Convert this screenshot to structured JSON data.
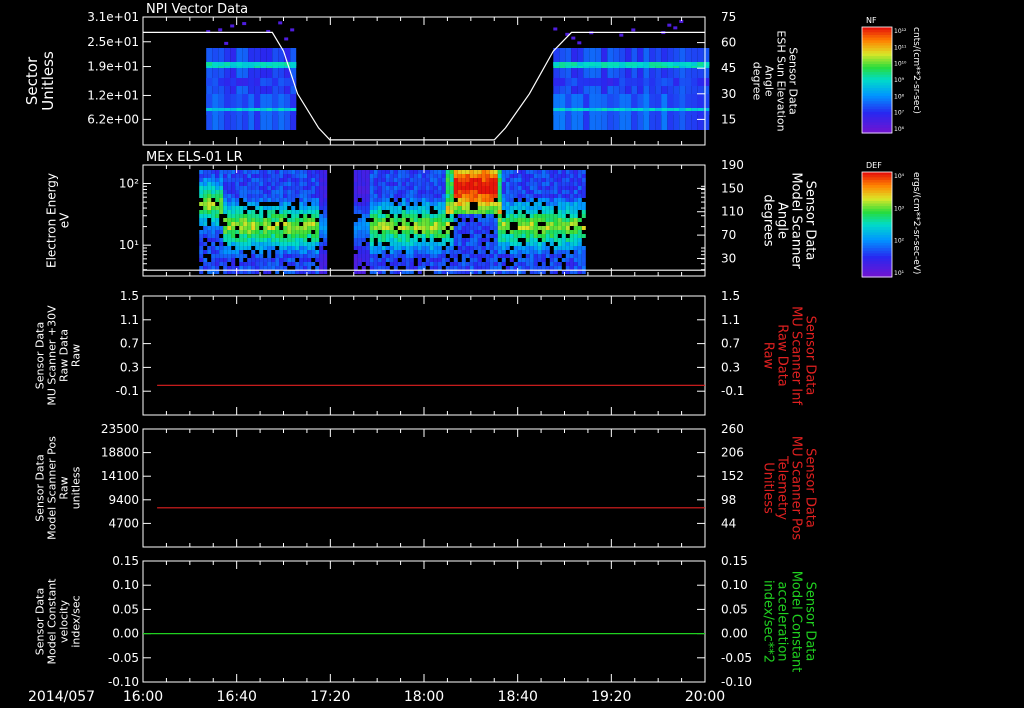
{
  "footer": {
    "date_label": "2014/057"
  },
  "colors": {
    "axis": "#ffffff",
    "red": "#e02020",
    "green": "#20d020",
    "bg": "#000000"
  },
  "chart_data": [
    {
      "id": "p1",
      "type": "heatmap",
      "title": "NPI Vector Data",
      "ylabel_left": [
        "Sector",
        "Unitless"
      ],
      "ylabel_right": [
        "Sensor Data",
        "ESH Sun Elevation",
        "Angle",
        "degree"
      ],
      "ylim_left": [
        0,
        31
      ],
      "yticks_left": [
        {
          "v": 6.2,
          "label": "6.2e+00"
        },
        {
          "v": 12,
          "label": "1.2e+01"
        },
        {
          "v": 19,
          "label": "1.9e+01"
        },
        {
          "v": 25,
          "label": "2.5e+01"
        },
        {
          "v": 31,
          "label": "3.1e+01"
        }
      ],
      "ylim_right": [
        0,
        75
      ],
      "yticks_right": [
        {
          "v": 15,
          "label": "15"
        },
        {
          "v": 30,
          "label": "30"
        },
        {
          "v": 45,
          "label": "45"
        },
        {
          "v": 60,
          "label": "60"
        },
        {
          "v": 75,
          "label": "75"
        }
      ],
      "data_coverage_hours": [
        [
          16.45,
          17.05
        ],
        [
          18.92,
          20.0
        ]
      ],
      "line_right": {
        "x": [
          16.0,
          16.92,
          17.0,
          17.1,
          17.25,
          17.33,
          18.5,
          18.58,
          18.75,
          18.92,
          19.05,
          20.0
        ],
        "y": [
          66,
          66,
          55,
          30,
          10,
          3,
          3,
          10,
          30,
          55,
          66,
          66
        ]
      },
      "colorbar": {
        "label": "NF",
        "unit": "cnts/(cm**2-sr-sec)",
        "ticks": [
          "10¹²",
          "10¹¹",
          "10¹⁰",
          "10⁹",
          "10⁸",
          "10⁷",
          "10⁶"
        ]
      }
    },
    {
      "id": "p2",
      "type": "heatmap",
      "title": "MEx ELS-01 LR",
      "ylabel_left": [
        "Electron Energy",
        "eV"
      ],
      "ylabel_right": [
        "Sensor Data",
        "Model Scanner",
        "Angle",
        "degrees"
      ],
      "ylim_left_log": [
        0.5,
        2.3
      ],
      "yticks_left": [
        {
          "v": 1,
          "label": "10¹"
        },
        {
          "v": 2,
          "label": "10²"
        }
      ],
      "ylim_right": [
        0,
        190
      ],
      "yticks_right": [
        {
          "v": 30,
          "label": "30"
        },
        {
          "v": 70,
          "label": "70"
        },
        {
          "v": 110,
          "label": "110"
        },
        {
          "v": 150,
          "label": "150"
        },
        {
          "v": 190,
          "label": "190"
        }
      ],
      "data_coverage_hours": [
        [
          16.4,
          17.3
        ],
        [
          17.5,
          19.15
        ]
      ],
      "line_right": {
        "x": [
          16.0,
          20.0
        ],
        "y": [
          10,
          10
        ]
      },
      "colorbar": {
        "label": "DEF",
        "unit": "ergs/(cm**2-sr-sec-eV)",
        "ticks": [
          "10⁴",
          "10³",
          "10²",
          "10¹"
        ]
      }
    },
    {
      "id": "p3",
      "type": "line",
      "ylabel_left": [
        "Sensor Data",
        "MU Scanner +30V",
        "Raw Data",
        "Raw"
      ],
      "ylabel_right": [
        "Sensor Data",
        "MU Scanner Inf",
        "Raw Data",
        "Raw"
      ],
      "ylim_left": [
        -0.5,
        1.5
      ],
      "yticks_left": [
        {
          "v": -0.1,
          "label": "-0.1"
        },
        {
          "v": 0.3,
          "label": "0.3"
        },
        {
          "v": 0.7,
          "label": "0.7"
        },
        {
          "v": 1.1,
          "label": "1.1"
        },
        {
          "v": 1.5,
          "label": "1.5"
        }
      ],
      "ylim_right": [
        -0.5,
        1.5
      ],
      "yticks_right": [
        {
          "v": -0.1,
          "label": "-0.1"
        },
        {
          "v": 0.3,
          "label": "0.3"
        },
        {
          "v": 0.7,
          "label": "0.7"
        },
        {
          "v": 1.1,
          "label": "1.1"
        },
        {
          "v": 1.5,
          "label": "1.5"
        }
      ],
      "series": [
        {
          "x": [
            16.1,
            20.0
          ],
          "y": [
            0.0,
            0.0
          ],
          "color": "#e02020"
        }
      ]
    },
    {
      "id": "p4",
      "type": "line",
      "ylabel_left": [
        "Sensor Data",
        "Model Scanner Pos",
        "Raw",
        "unitless"
      ],
      "ylabel_right": [
        "Sensor Data",
        "MU Scanner Pos",
        "Telemetry",
        "Unitless"
      ],
      "ylim_left": [
        0,
        23500
      ],
      "yticks_left": [
        {
          "v": 4700,
          "label": "4700"
        },
        {
          "v": 9400,
          "label": "9400"
        },
        {
          "v": 14100,
          "label": "14100"
        },
        {
          "v": 18800,
          "label": "18800"
        },
        {
          "v": 23500,
          "label": "23500"
        }
      ],
      "ylim_right": [
        -10,
        260
      ],
      "yticks_right": [
        {
          "v": 44,
          "label": "44"
        },
        {
          "v": 98,
          "label": "98"
        },
        {
          "v": 152,
          "label": "152"
        },
        {
          "v": 206,
          "label": "206"
        },
        {
          "v": 260,
          "label": "260"
        }
      ],
      "series": [
        {
          "x": [
            16.1,
            20.0
          ],
          "y": [
            7800,
            7800
          ],
          "color": "#e02020"
        }
      ]
    },
    {
      "id": "p5",
      "type": "line",
      "ylabel_left": [
        "Sensor Data",
        "Model Constant",
        "velocity",
        "index/sec"
      ],
      "ylabel_right": [
        "Sensor Data",
        "Model Constant",
        "acceleration",
        "index/sec**2"
      ],
      "ylim_left": [
        -0.1,
        0.15
      ],
      "yticks_left": [
        {
          "v": -0.1,
          "label": "-0.10"
        },
        {
          "v": -0.05,
          "label": "-0.05"
        },
        {
          "v": 0.0,
          "label": "0.00"
        },
        {
          "v": 0.05,
          "label": "0.05"
        },
        {
          "v": 0.1,
          "label": "0.10"
        },
        {
          "v": 0.15,
          "label": "0.15"
        }
      ],
      "ylim_right": [
        -0.1,
        0.15
      ],
      "yticks_right": [
        {
          "v": -0.1,
          "label": "-0.10"
        },
        {
          "v": -0.05,
          "label": "-0.05"
        },
        {
          "v": 0.0,
          "label": "0.00"
        },
        {
          "v": 0.05,
          "label": "0.05"
        },
        {
          "v": 0.1,
          "label": "0.10"
        },
        {
          "v": 0.15,
          "label": "0.15"
        }
      ],
      "series": [
        {
          "x": [
            16.0,
            20.0
          ],
          "y": [
            0.0,
            0.0
          ],
          "color": "#20d020"
        }
      ]
    }
  ],
  "xaxis": {
    "range_hours": [
      16.0,
      20.0
    ],
    "ticks": [
      {
        "v": 16.0,
        "label": "16:00"
      },
      {
        "v": 16.667,
        "label": "16:40"
      },
      {
        "v": 17.333,
        "label": "17:20"
      },
      {
        "v": 18.0,
        "label": "18:00"
      },
      {
        "v": 18.667,
        "label": "18:40"
      },
      {
        "v": 19.333,
        "label": "19:20"
      },
      {
        "v": 20.0,
        "label": "20:00"
      }
    ]
  }
}
